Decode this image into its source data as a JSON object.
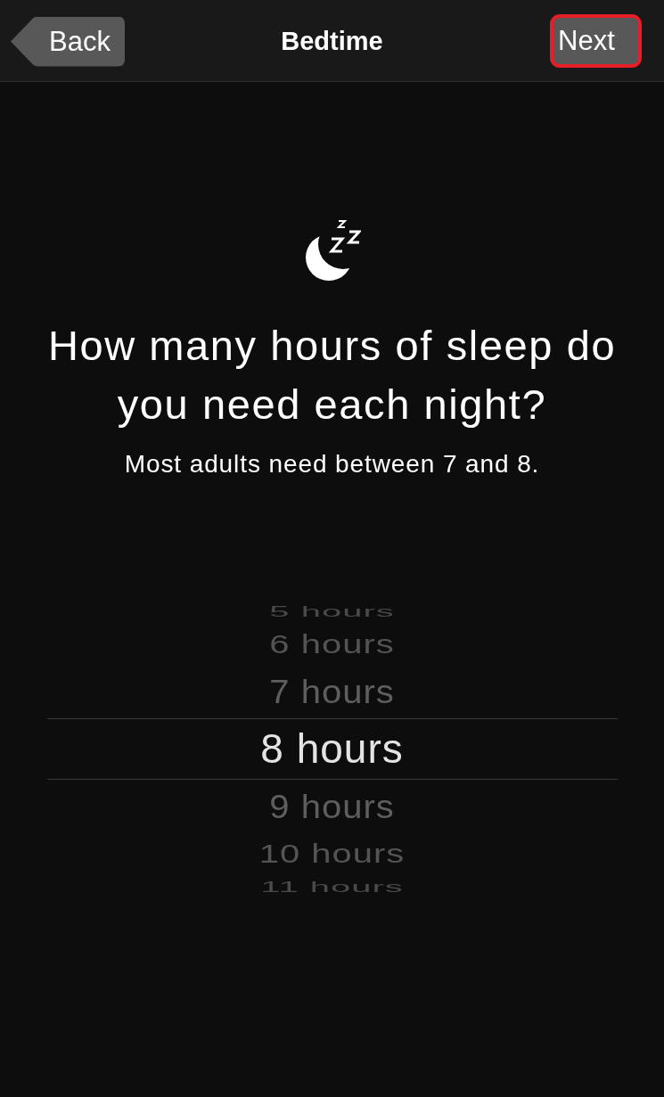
{
  "nav_bar": {
    "back_button": "Back",
    "title": "Bedtime",
    "next_button": {
      "label": "Next",
      "highlighted": true
    }
  },
  "prompt": {
    "heading": "How many hours of sleep do you need each night?",
    "subtitle": "Most adults need between 7 and 8."
  },
  "picker": {
    "options": [
      {
        "label": "5 hours",
        "selected": false
      },
      {
        "label": "6 hours",
        "selected": false
      },
      {
        "label": "7 hours",
        "selected": false
      },
      {
        "label": "8 hours",
        "selected": true
      },
      {
        "label": "9 hours",
        "selected": false
      },
      {
        "label": "10 hours",
        "selected": false
      },
      {
        "label": "11 hours",
        "selected": false
      }
    ]
  }
}
